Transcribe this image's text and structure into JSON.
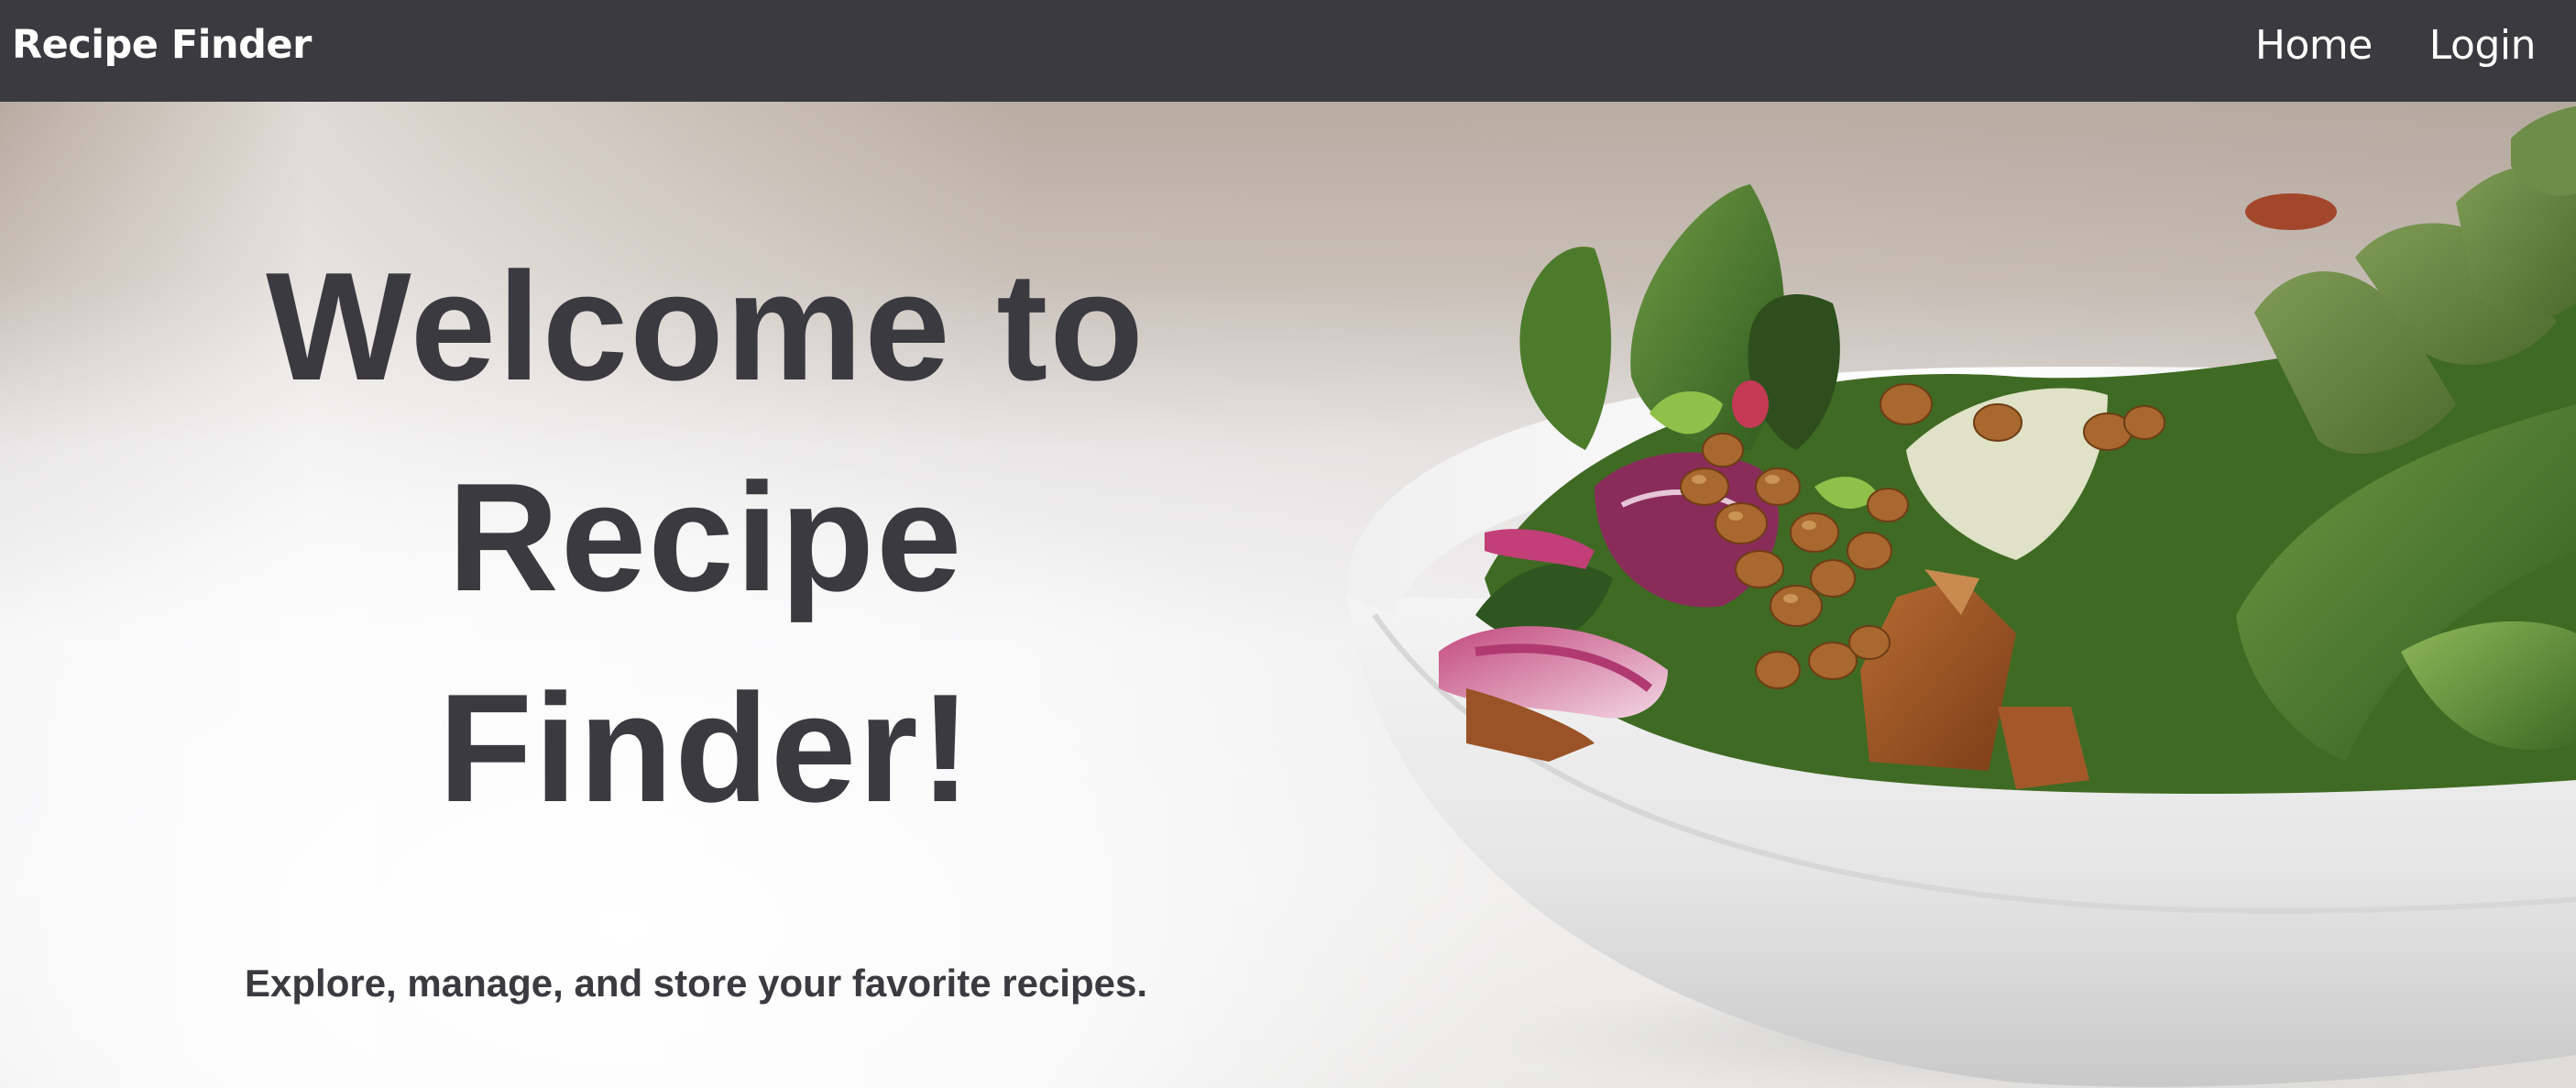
{
  "navbar": {
    "brand": "Recipe Finder",
    "links": [
      {
        "label": "Home"
      },
      {
        "label": "Login"
      }
    ],
    "background": "#3b3a41"
  },
  "hero": {
    "headline": "Welcome to Recipe Finder!",
    "tagline": "Explore, manage, and store your favorite recipes.",
    "text_color": "#3b3a41",
    "image": "salad-bowl-photo"
  }
}
